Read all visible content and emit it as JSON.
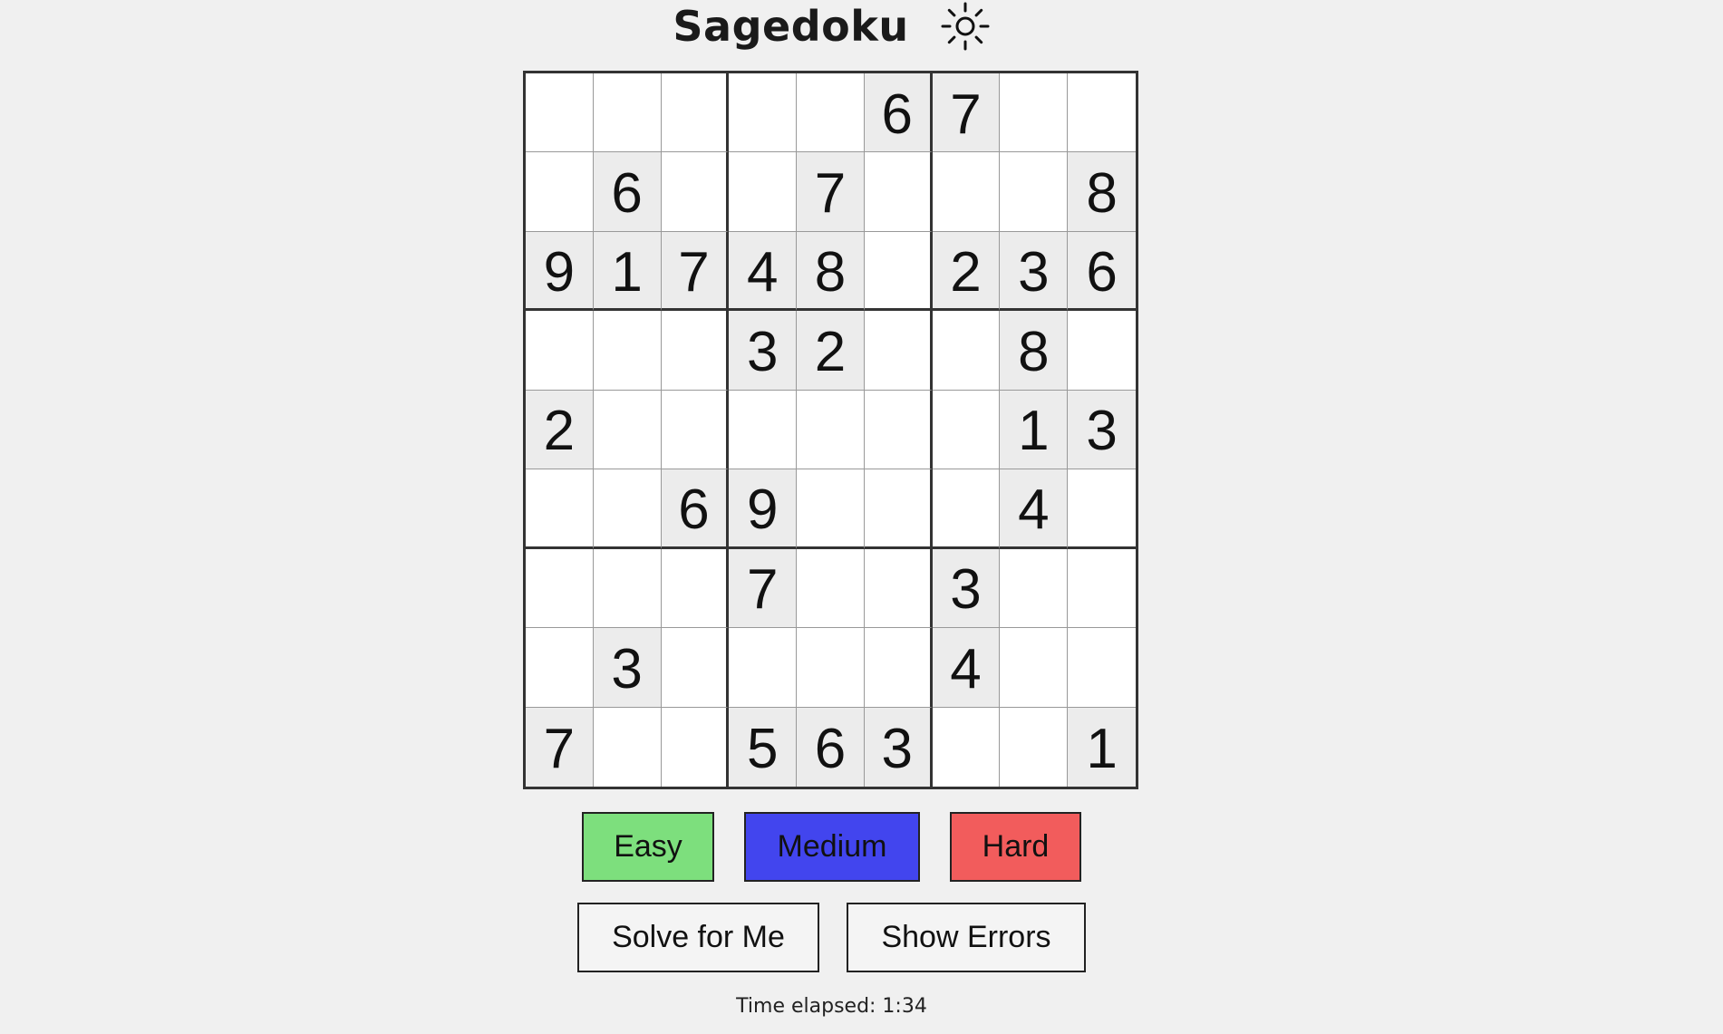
{
  "app": {
    "title": "Sagedoku",
    "theme_icon": "sun-icon"
  },
  "board": {
    "rows": [
      [
        "",
        "",
        "",
        "",
        "",
        "6",
        "7",
        "",
        ""
      ],
      [
        "",
        "6",
        "",
        "",
        "7",
        "",
        "",
        "",
        "8"
      ],
      [
        "9",
        "1",
        "7",
        "4",
        "8",
        "",
        "2",
        "3",
        "6"
      ],
      [
        "",
        "",
        "",
        "3",
        "2",
        "",
        "",
        "8",
        ""
      ],
      [
        "2",
        "",
        "",
        "",
        "",
        "",
        "",
        "1",
        "3"
      ],
      [
        "",
        "",
        "6",
        "9",
        "",
        "",
        "",
        "4",
        ""
      ],
      [
        "",
        "",
        "",
        "7",
        "",
        "",
        "3",
        "",
        ""
      ],
      [
        "",
        "3",
        "",
        "",
        "",
        "",
        "4",
        "",
        ""
      ],
      [
        "7",
        "",
        "",
        "5",
        "6",
        "3",
        "",
        "",
        "1"
      ]
    ],
    "given_color": "#ececec",
    "empty_color": "#ffffff"
  },
  "difficulty": {
    "easy_label": "Easy",
    "medium_label": "Medium",
    "hard_label": "Hard",
    "easy_color": "#7ddf7d",
    "medium_color": "#4245ee",
    "hard_color": "#f25c5c"
  },
  "actions": {
    "solve_label": "Solve for Me",
    "errors_label": "Show Errors"
  },
  "timer": {
    "text": "Time elapsed: 1:34"
  }
}
